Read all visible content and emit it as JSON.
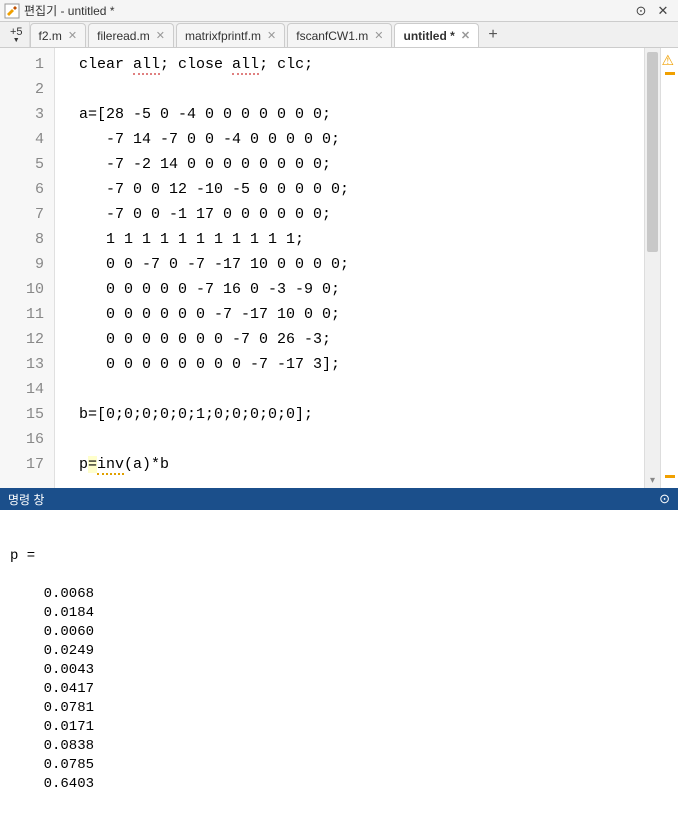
{
  "window": {
    "title": "편집기 - untitled *",
    "minimize_icon": "⊙",
    "close_icon": "✕"
  },
  "zoom": {
    "label": "+5"
  },
  "tabs": {
    "items": [
      {
        "label": "f2.m",
        "active": false
      },
      {
        "label": "fileread.m",
        "active": false
      },
      {
        "label": "matrixfprintf.m",
        "active": false
      },
      {
        "label": "fscanfCW1.m",
        "active": false
      },
      {
        "label": "untitled *",
        "active": true
      }
    ],
    "close_glyph": "✕",
    "add_glyph": "+"
  },
  "editor": {
    "lines": [
      {
        "n": "1",
        "segments": [
          [
            "plain",
            "clear "
          ],
          [
            "ul-red",
            "all"
          ],
          [
            "plain",
            "; close "
          ],
          [
            "ul-red",
            "all"
          ],
          [
            "plain",
            "; clc;"
          ]
        ]
      },
      {
        "n": "2",
        "segments": []
      },
      {
        "n": "3",
        "segments": [
          [
            "plain",
            "a=[28 -5 0 -4 0 0 0 0 0 0 0;"
          ]
        ]
      },
      {
        "n": "4",
        "segments": [
          [
            "plain",
            "   -7 14 -7 0 0 -4 0 0 0 0 0;"
          ]
        ]
      },
      {
        "n": "5",
        "segments": [
          [
            "plain",
            "   -7 -2 14 0 0 0 0 0 0 0 0;"
          ]
        ]
      },
      {
        "n": "6",
        "segments": [
          [
            "plain",
            "   -7 0 0 12 -10 -5 0 0 0 0 0;"
          ]
        ]
      },
      {
        "n": "7",
        "segments": [
          [
            "plain",
            "   -7 0 0 -1 17 0 0 0 0 0 0;"
          ]
        ]
      },
      {
        "n": "8",
        "segments": [
          [
            "plain",
            "   1 1 1 1 1 1 1 1 1 1 1;"
          ]
        ]
      },
      {
        "n": "9",
        "segments": [
          [
            "plain",
            "   0 0 -7 0 -7 -17 10 0 0 0 0;"
          ]
        ]
      },
      {
        "n": "10",
        "segments": [
          [
            "plain",
            "   0 0 0 0 0 -7 16 0 -3 -9 0;"
          ]
        ]
      },
      {
        "n": "11",
        "segments": [
          [
            "plain",
            "   0 0 0 0 0 0 -7 -17 10 0 0;"
          ]
        ]
      },
      {
        "n": "12",
        "segments": [
          [
            "plain",
            "   0 0 0 0 0 0 0 -7 0 26 -3;"
          ]
        ]
      },
      {
        "n": "13",
        "segments": [
          [
            "plain",
            "   0 0 0 0 0 0 0 0 -7 -17 3];"
          ]
        ]
      },
      {
        "n": "14",
        "segments": []
      },
      {
        "n": "15",
        "segments": [
          [
            "plain",
            "b=[0;0;0;0;0;1;0;0;0;0;0];"
          ]
        ]
      },
      {
        "n": "16",
        "segments": []
      },
      {
        "n": "17",
        "segments": [
          [
            "plain",
            "p"
          ],
          [
            "hl",
            "="
          ],
          [
            "ul-orange",
            "inv"
          ],
          [
            "plain",
            "(a)*b"
          ]
        ]
      }
    ]
  },
  "cmd": {
    "title": "명령 창",
    "minimize_glyph": "⊙",
    "output_header": "p =",
    "output_values": [
      "0.0068",
      "0.0184",
      "0.0060",
      "0.0249",
      "0.0043",
      "0.0417",
      "0.0781",
      "0.0171",
      "0.0838",
      "0.0785",
      "0.6403"
    ]
  }
}
